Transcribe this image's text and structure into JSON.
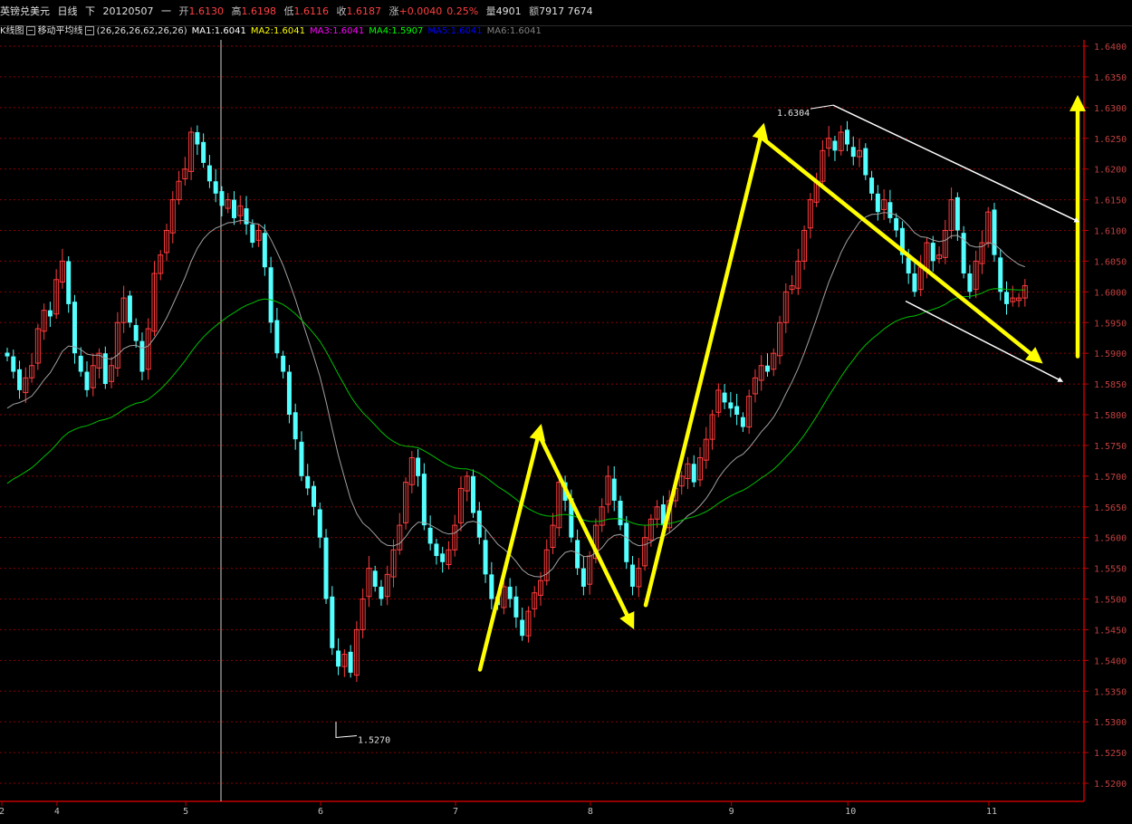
{
  "title_bar": {
    "symbol": "英镑兑美元",
    "period": "日线",
    "direction": "下",
    "date": "20120507",
    "weekday": "一",
    "open_label": "开",
    "open": "1.6130",
    "high_label": "高",
    "high": "1.6198",
    "low_label": "低",
    "low": "1.6116",
    "close_label": "收",
    "close": "1.6187",
    "change_label": "涨",
    "change": "+0.0040",
    "change_pct": "0.25%",
    "volume_label": "量",
    "volume": "4901",
    "amount_label": "额",
    "amount": "7917 7674"
  },
  "indicator_bar": {
    "kline_label": "K线图",
    "ma_name": "移动平均线",
    "ma_params": "(26,26,26,62,26,26)",
    "ma1": "MA1:1.6041",
    "ma2": "MA2:1.6041",
    "ma3": "MA3:1.6041",
    "ma4": "MA4:1.5907",
    "ma5": "MA5:1.6041",
    "ma6": "MA6:1.6041"
  },
  "colors": {
    "background": "#000000",
    "grid": "#8b0000",
    "axis": "#c00000",
    "price_label": "#c04040",
    "up_candle": "#ff3c3c",
    "down_candle": "#54ffff",
    "ma_gray": "#a0a0a0",
    "ma_green": "#00c000",
    "ma1": "#ffffff",
    "ma2": "#ffff00",
    "ma3": "#ff00ff",
    "ma4": "#00ff00",
    "ma5": "#0000ff",
    "ma6": "#808080",
    "arrow_yellow": "#ffff00",
    "channel_white": "#ffffff"
  },
  "price_axis": {
    "min": 1.52,
    "max": 1.64,
    "step": 0.005,
    "labels": [
      "1.6400",
      "1.6350",
      "1.6300",
      "1.6250",
      "1.6200",
      "1.6150",
      "1.6100",
      "1.6050",
      "1.6000",
      "1.5950",
      "1.5900",
      "1.5850",
      "1.5800",
      "1.5750",
      "1.5700",
      "1.5650",
      "1.5600",
      "1.5550",
      "1.5500",
      "1.5450",
      "1.5400",
      "1.5350",
      "1.5300",
      "1.5250",
      "1.5200"
    ]
  },
  "time_axis": {
    "labels": [
      {
        "text": "2",
        "index": 0
      },
      {
        "text": "4",
        "index": 9
      },
      {
        "text": "5",
        "index": 30
      },
      {
        "text": "6",
        "index": 52
      },
      {
        "text": "7",
        "index": 74
      },
      {
        "text": "8",
        "index": 96
      },
      {
        "text": "9",
        "index": 119
      },
      {
        "text": "10",
        "index": 138
      },
      {
        "text": "11",
        "index": 161
      }
    ]
  },
  "annotations": {
    "high_mark": "1.6304",
    "low_mark": "1.5270"
  },
  "chart_data": {
    "type": "candlestick",
    "title": "",
    "xlabel": "",
    "ylabel": "",
    "ylim": [
      1.52,
      1.64
    ],
    "grid": true,
    "closes": [
      1.5895,
      1.587,
      1.584,
      1.586,
      1.588,
      1.594,
      1.597,
      1.596,
      1.602,
      1.605,
      1.598,
      1.59,
      1.587,
      1.584,
      1.588,
      1.59,
      1.585,
      1.588,
      1.595,
      1.599,
      1.595,
      1.592,
      1.587,
      1.594,
      1.603,
      1.606,
      1.61,
      1.615,
      1.618,
      1.62,
      1.626,
      1.624,
      1.621,
      1.618,
      1.616,
      1.614,
      1.615,
      1.612,
      1.614,
      1.611,
      1.608,
      1.61,
      1.604,
      1.595,
      1.59,
      1.587,
      1.58,
      1.576,
      1.57,
      1.568,
      1.565,
      1.56,
      1.55,
      1.542,
      1.539,
      1.541,
      1.538,
      1.545,
      1.55,
      1.555,
      1.552,
      1.55,
      1.554,
      1.558,
      1.562,
      1.569,
      1.573,
      1.57,
      1.562,
      1.559,
      1.557,
      1.556,
      1.558,
      1.562,
      1.568,
      1.57,
      1.564,
      1.56,
      1.554,
      1.55,
      1.549,
      1.552,
      1.55,
      1.547,
      1.544,
      1.548,
      1.551,
      1.553,
      1.558,
      1.562,
      1.569,
      1.566,
      1.56,
      1.555,
      1.552,
      1.557,
      1.562,
      1.565,
      1.57,
      1.566,
      1.562,
      1.556,
      1.552,
      1.555,
      1.56,
      1.563,
      1.565,
      1.562,
      1.566,
      1.568,
      1.57,
      1.572,
      1.569,
      1.573,
      1.576,
      1.58,
      1.584,
      1.582,
      1.581,
      1.58,
      1.578,
      1.583,
      1.586,
      1.588,
      1.587,
      1.59,
      1.595,
      1.6,
      1.601,
      1.605,
      1.61,
      1.615,
      1.618,
      1.623,
      1.625,
      1.623,
      1.626,
      1.624,
      1.622,
      1.623,
      1.619,
      1.616,
      1.613,
      1.615,
      1.612,
      1.61,
      1.606,
      1.603,
      1.6,
      1.604,
      1.608,
      1.605,
      1.606,
      1.61,
      1.615,
      1.61,
      1.603,
      1.6,
      1.605,
      1.608,
      1.613,
      1.606,
      1.6,
      1.598,
      1.599,
      1.599,
      1.601
    ],
    "ma_fast_start": 1.58,
    "ma_slow_start": 1.568,
    "arrows_yellow": [
      {
        "from_x": 1.5,
        "from_y": 1.5385,
        "to_x": 2.4,
        "to_y": 1.5775
      },
      {
        "from_x": 2.4,
        "from_y": 1.5765,
        "to_x": 2.9,
        "to_y": 1.546
      },
      {
        "from_x": 2.95,
        "from_y": 1.549,
        "to_x": 3.9,
        "to_y": 1.6265
      },
      {
        "from_x": 3.9,
        "from_y": 1.625,
        "to_x": 5.65,
        "to_y": 1.589
      },
      {
        "from_x": 6.1,
        "from_y": 1.5895,
        "to_x": 6.1,
        "to_y": 1.631
      }
    ],
    "channel_white": [
      {
        "from_x": 4.6,
        "from_y": 1.6304,
        "to_x": 6.1,
        "to_y": 1.6115
      },
      {
        "from_x": 5.45,
        "from_y": 1.5985,
        "to_x": 6.05,
        "to_y": 1.5855
      }
    ]
  }
}
